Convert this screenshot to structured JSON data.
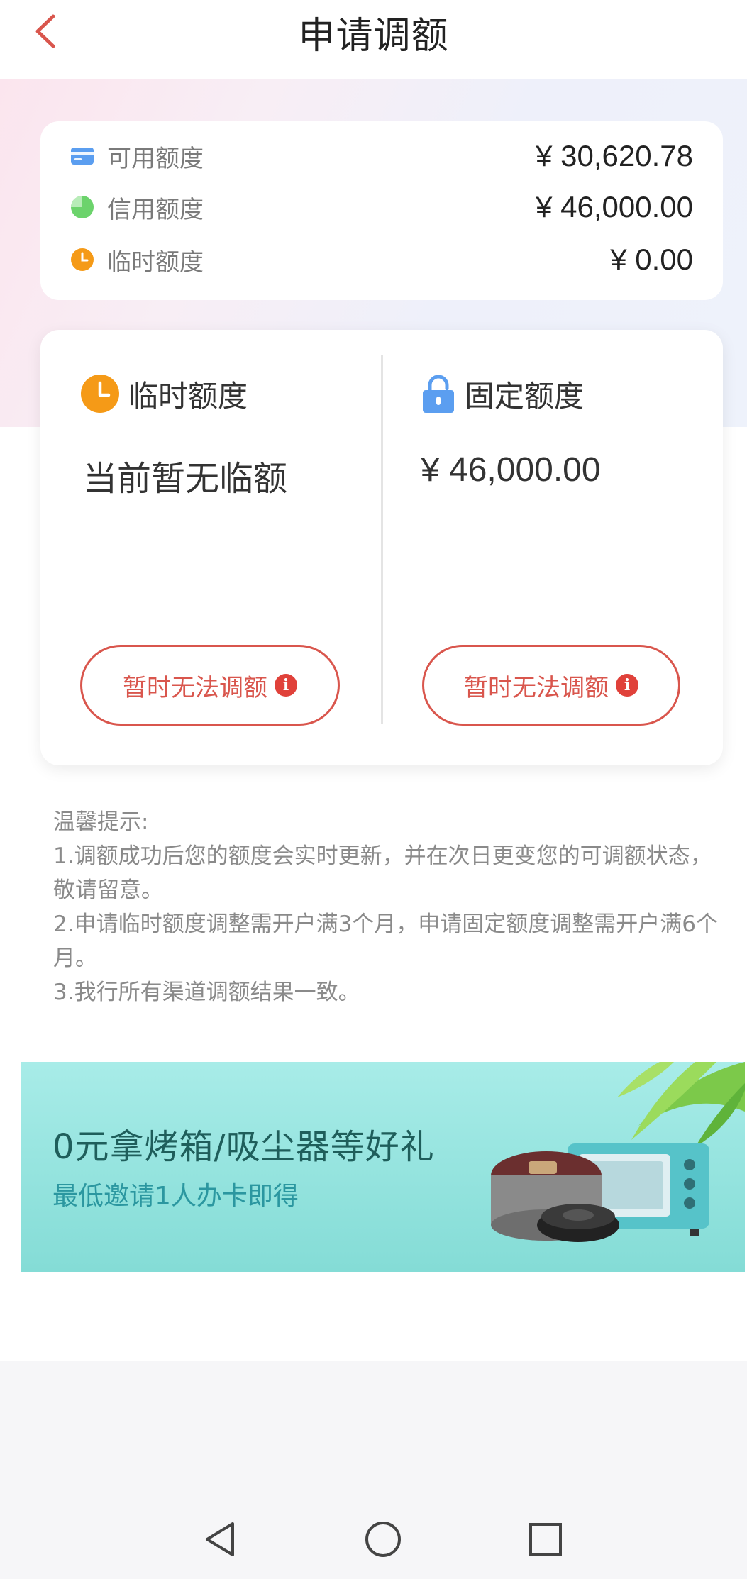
{
  "header": {
    "title": "申请调额",
    "back_icon": "chevron-left-icon"
  },
  "summary": {
    "rows": [
      {
        "icon": "card-icon",
        "label": "可用额度",
        "value": "¥ 30,620.78"
      },
      {
        "icon": "pie-icon",
        "label": "信用额度",
        "value": "¥ 46,000.00"
      },
      {
        "icon": "clock-icon",
        "label": "临时额度",
        "value": "¥ 0.00"
      }
    ]
  },
  "limits": {
    "temporary": {
      "icon": "clock-icon",
      "label": "临时额度",
      "value": "当前暂无临额",
      "button_label": "暂时无法调额"
    },
    "fixed": {
      "icon": "lock-icon",
      "label": "固定额度",
      "value": "¥ 46,000.00",
      "button_label": "暂时无法调额"
    },
    "info_glyph": "i"
  },
  "tips": {
    "title": "温馨提示:",
    "items": [
      "1.调额成功后您的额度会实时更新，并在次日更变您的可调额状态，敬请留意。",
      "2.申请临时额度调整需开户满3个月，申请固定额度调整需开户满6个月。",
      "3.我行所有渠道调额结果一致。"
    ]
  },
  "banner": {
    "title": "0元拿烤箱/吸尘器等好礼",
    "subtitle": "最低邀请1人办卡即得"
  },
  "colors": {
    "accent_red": "#d9564d",
    "info_red": "#e0413a",
    "clock_orange": "#f59a17",
    "lock_blue": "#5b9ef0",
    "card_blue": "#5b9ef0",
    "pie_green": "#6cd36c",
    "banner_teal": "#84dcd6"
  },
  "system_nav": [
    "back-triangle-icon",
    "home-circle-icon",
    "recents-square-icon"
  ]
}
